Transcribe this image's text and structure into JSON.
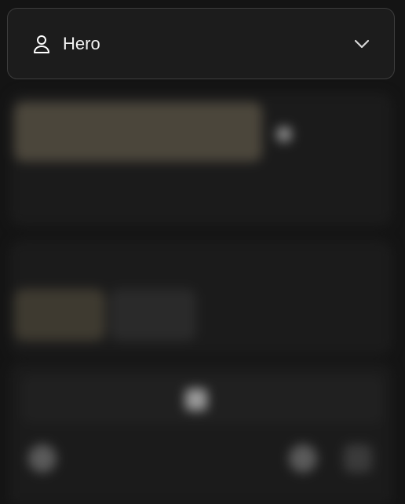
{
  "header": {
    "title": "Hero",
    "user_icon": "user-icon",
    "chevron_icon": "chevron-down-icon"
  },
  "blurred": {
    "pill_text": "",
    "side_toggle_text": "",
    "hint_text": "",
    "section_title": "",
    "segments": [
      "",
      "",
      "",
      ""
    ],
    "tool_title": "",
    "center_value": ""
  },
  "colors": {
    "background": "#141414",
    "header_bg": "#1c1c1c",
    "header_border": "#3d3d3d",
    "accent_muted": "#4b463b"
  }
}
